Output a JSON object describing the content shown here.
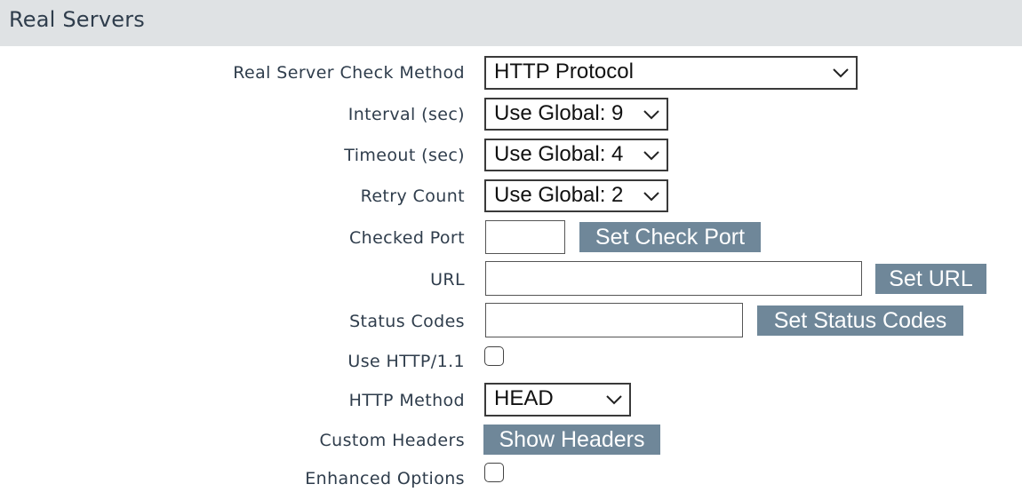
{
  "section": {
    "title": "Real Servers"
  },
  "fields": {
    "check_method": {
      "label": "Real Server Check Method",
      "value": "HTTP Protocol"
    },
    "interval": {
      "label": "Interval (sec)",
      "value": "Use Global: 9"
    },
    "timeout": {
      "label": "Timeout (sec)",
      "value": "Use Global: 4"
    },
    "retry": {
      "label": "Retry Count",
      "value": "Use Global: 2"
    },
    "checked_port": {
      "label": "Checked Port",
      "value": "",
      "button": "Set Check Port"
    },
    "url": {
      "label": "URL",
      "value": "",
      "button": "Set URL"
    },
    "status_codes": {
      "label": "Status Codes",
      "value": "",
      "button": "Set Status Codes"
    },
    "use_http11": {
      "label": "Use HTTP/1.1",
      "checked": false
    },
    "http_method": {
      "label": "HTTP Method",
      "value": "HEAD"
    },
    "custom_headers": {
      "label": "Custom Headers",
      "button": "Show Headers"
    },
    "enhanced_options": {
      "label": "Enhanced Options",
      "checked": false
    }
  },
  "icons": {
    "dropdown": "chevron-down-icon"
  },
  "colors": {
    "header_bg": "#dfe2e4",
    "text": "#2f3d4c",
    "button_bg": "#6f8799"
  }
}
